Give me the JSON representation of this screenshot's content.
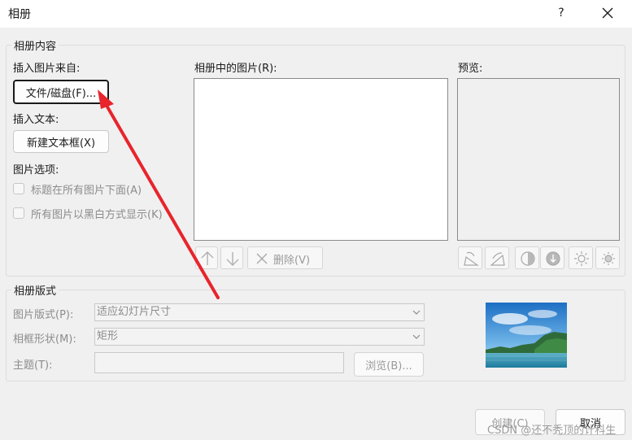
{
  "window": {
    "title": "相册",
    "help": "?"
  },
  "content_group": {
    "title": "相册内容",
    "insert_picture_from": "插入图片来自:",
    "file_disk_button": "文件/磁盘(F)...",
    "insert_text": "插入文本:",
    "new_textbox_button": "新建文本框(X)",
    "picture_options": "图片选项:",
    "options": [
      {
        "label": "标题在所有图片下面(A)",
        "checked": false
      },
      {
        "label": "所有图片以黑白方式显示(K)",
        "checked": false
      }
    ],
    "pictures_in_album_label": "相册中的图片(R):",
    "preview_label": "预览:",
    "delete_button": "删除(V)"
  },
  "layout_group": {
    "title": "相册版式",
    "picture_layout_label": "图片版式(P):",
    "picture_layout_value": "适应幻灯片尺寸",
    "frame_shape_label": "相框形状(M):",
    "frame_shape_value": "矩形",
    "theme_label": "主题(T):",
    "theme_value": "",
    "browse_button": "浏览(B)..."
  },
  "footer": {
    "create_button": "创建(C)",
    "cancel_button": "取消"
  },
  "watermark": "CSDN @还不秃顶的计科生",
  "colors": {
    "annotation_arrow": "#e8242c",
    "focus_border": "#1a1a1a"
  }
}
